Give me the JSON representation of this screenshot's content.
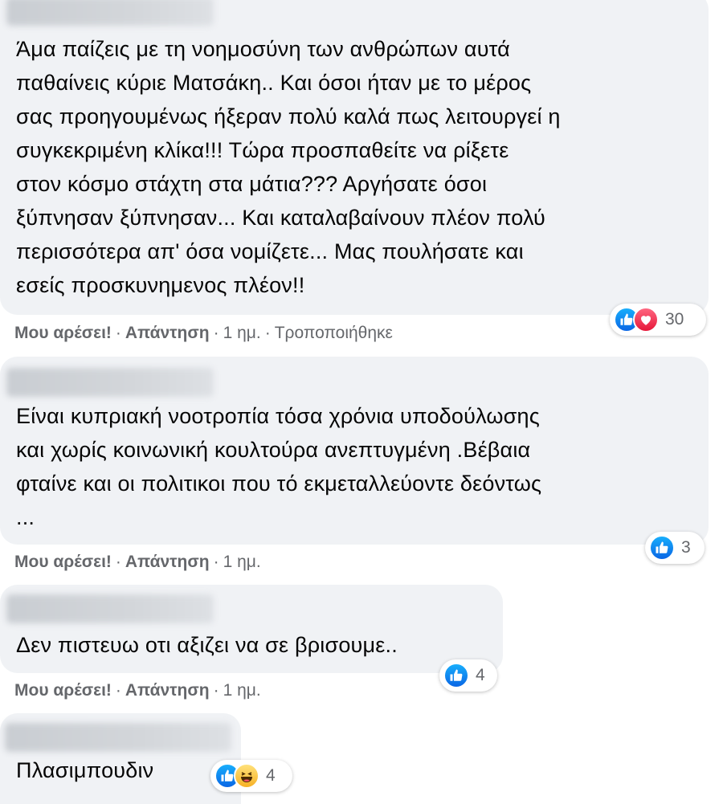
{
  "comments": [
    {
      "text": "Άμα παίζεις με τη νοημοσύνη των ανθρώπων αυτά\nπαθαίνεις κύριε Ματσάκη.. Και όσοι ήταν με το μέρος\nσας προηγουμένως ήξεραν πολύ καλά πως λειτουργεί η\nσυγκεκριμένη κλίκα!!! Τώρα προσπαθείτε να ρίξετε\nστον κόσμο στάχτη στα μάτια??? Αργήσατε όσοι\nξύπνησαν ξύπνησαν... Και καταλαβαίνουν πλέον πολύ\nπερισσότερα απ' όσα νομίζετε... Μας πουλήσατε και\nεσείς προσκυνημενος πλέον!!",
      "like_label": "Μου αρέσει!",
      "reply_label": "Απάντηση",
      "time": "1 ημ.",
      "edited": "Τροποποιήθηκε",
      "reaction_icons": [
        "like-icon",
        "love-icon"
      ],
      "reaction_count": "30"
    },
    {
      "text": "Είναι κυπριακή νοοτροπία τόσα χρόνια υποδούλωσης\nκαι χωρίς κοινωνική κουλτούρα ανεπτυγμένη .Βέβαια\nφταίνε και οι πολιτικοι που τό εκμεταλλεύοντε δεόντως\n...",
      "like_label": "Μου αρέσει!",
      "reply_label": "Απάντηση",
      "time": "1 ημ.",
      "reaction_icons": [
        "like-icon"
      ],
      "reaction_count": "3"
    },
    {
      "text": "Δεν πιστευω οτι αξιζει να σε βρισουμε..",
      "like_label": "Μου αρέσει!",
      "reply_label": "Απάντηση",
      "time": "1 ημ.",
      "reaction_icons": [
        "like-icon"
      ],
      "reaction_count": "4"
    },
    {
      "text": "Πλασιμπουδιν",
      "reaction_icons": [
        "like-icon",
        "haha-icon"
      ],
      "reaction_count": "4"
    }
  ],
  "colors": {
    "bubble": "#f0f2f5",
    "meta_text": "#65676b",
    "like": "#1877f2",
    "love": "#f33e58",
    "haha": "#f7b125"
  }
}
